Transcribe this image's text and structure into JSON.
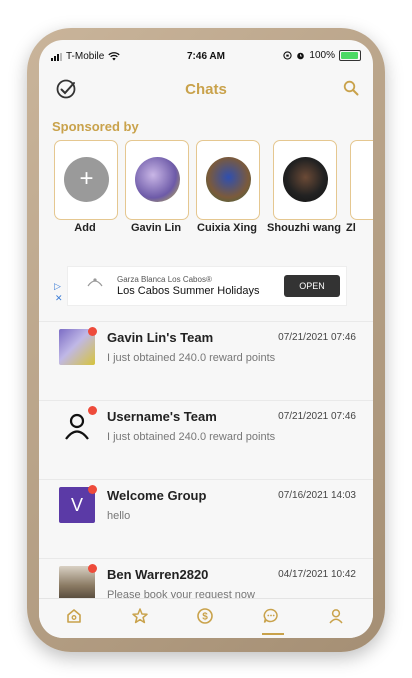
{
  "status_bar": {
    "carrier": "T-Mobile",
    "time": "7:46 AM",
    "battery": "100%"
  },
  "header": {
    "title": "Chats",
    "left_icon": "check-circle-icon",
    "right_icon": "search-icon"
  },
  "sponsored": {
    "label": "Sponsored by",
    "items": [
      {
        "name": "Add",
        "type": "add"
      },
      {
        "name": "Gavin Lin"
      },
      {
        "name": "Cuixia Xing"
      },
      {
        "name": "Shouzhi wang"
      },
      {
        "name": "Zl"
      }
    ]
  },
  "ad": {
    "advertiser": "Garza Blanca Los Cabos®",
    "headline": "Los Cabos Summer Holidays",
    "cta": "OPEN",
    "brand_mark": "GARZA BLANCA"
  },
  "chats": [
    {
      "name": "Gavin Lin's Team",
      "date": "07/21/2021 07:46",
      "message": "I just obtained 240.0 reward points",
      "unread": true,
      "avatar": "photo"
    },
    {
      "name": "Username's Team",
      "date": "07/21/2021 07:46",
      "message": "I just obtained 240.0 reward points",
      "unread": true,
      "avatar": "person-icon"
    },
    {
      "name": "Welcome Group",
      "date": "07/16/2021 14:03",
      "message": "hello",
      "unread": true,
      "avatar": "V"
    },
    {
      "name": "Ben Warren2820",
      "date": "04/17/2021 10:42",
      "message": "Please book your request now",
      "unread": true,
      "avatar": "photo"
    }
  ],
  "tabs": [
    {
      "name": "home",
      "icon": "home-icon"
    },
    {
      "name": "favorites",
      "icon": "star-icon"
    },
    {
      "name": "rewards",
      "icon": "dollar-icon"
    },
    {
      "name": "chats",
      "icon": "chat-icon",
      "active": true
    },
    {
      "name": "profile",
      "icon": "profile-icon"
    }
  ],
  "colors": {
    "accent": "#c9a24b",
    "unread_dot": "#ee4b3b",
    "welcome_avatar": "#5b3aa6"
  }
}
